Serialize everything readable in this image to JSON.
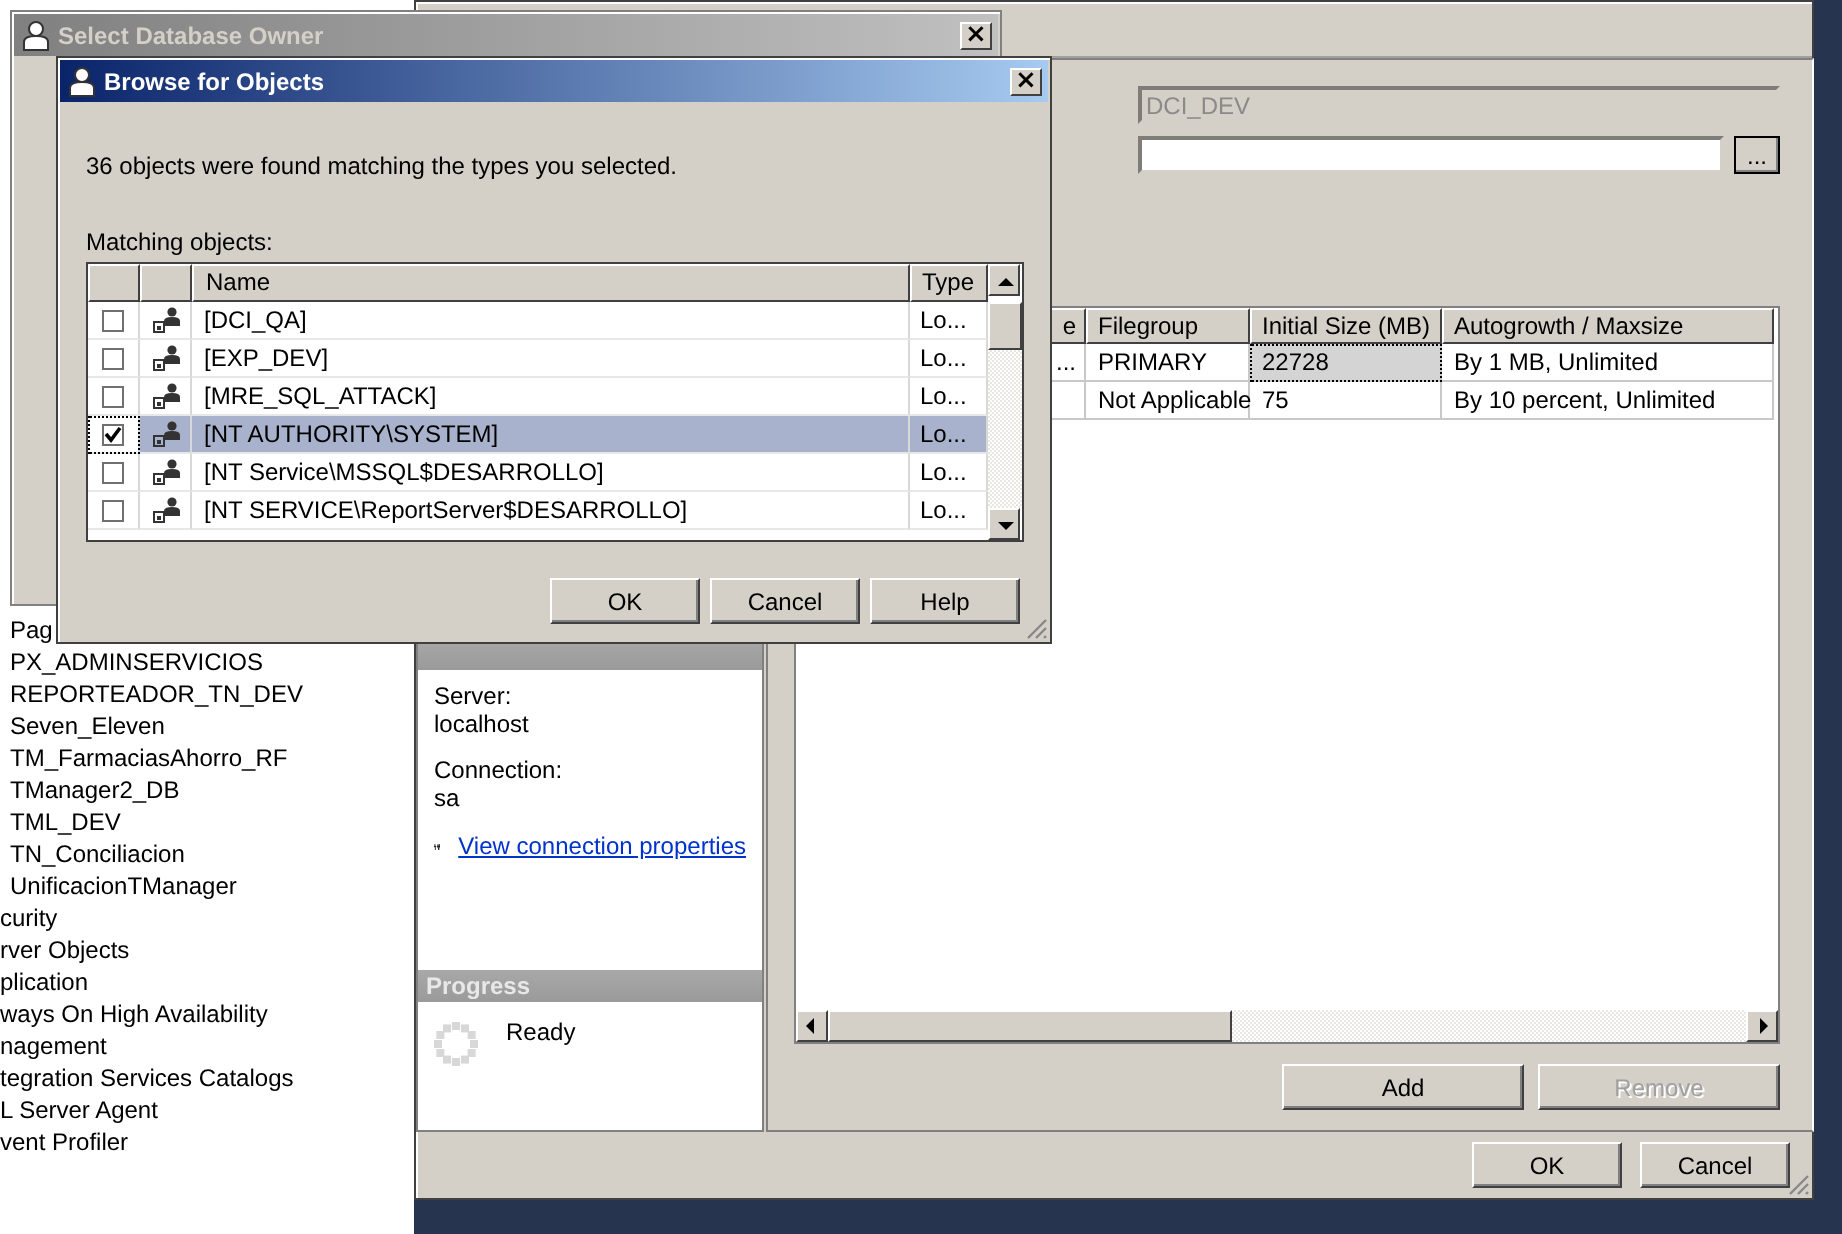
{
  "object_explorer": {
    "items": [
      {
        "label": "Pag",
        "kind": "database"
      },
      {
        "label": "PX_ADMINSERVICIOS",
        "kind": "database"
      },
      {
        "label": "REPORTEADOR_TN_DEV",
        "kind": "database"
      },
      {
        "label": "Seven_Eleven",
        "kind": "database"
      },
      {
        "label": "TM_FarmaciasAhorro_RF",
        "kind": "database"
      },
      {
        "label": "TManager2_DB",
        "kind": "database"
      },
      {
        "label": "TML_DEV",
        "kind": "database"
      },
      {
        "label": "TN_Conciliacion",
        "kind": "database"
      },
      {
        "label": "UnificacionTManager",
        "kind": "database"
      },
      {
        "label": "curity",
        "kind": "folder"
      },
      {
        "label": "rver Objects",
        "kind": "folder"
      },
      {
        "label": "plication",
        "kind": "folder"
      },
      {
        "label": "ways On High Availability",
        "kind": "folder"
      },
      {
        "label": "nagement",
        "kind": "folder"
      },
      {
        "label": "tegration Services Catalogs",
        "kind": "folder"
      },
      {
        "label": "L Server Agent",
        "kind": "folder"
      },
      {
        "label": "vent Profiler",
        "kind": "folder"
      }
    ]
  },
  "new_database_dialog": {
    "database_name": {
      "value": "DCI_DEV",
      "disabled": true
    },
    "owner_browse_button": "...",
    "connection": {
      "server_label": "Server:",
      "server": "localhost",
      "connection_label": "Connection:",
      "connection": "sa",
      "link": "View connection properties"
    },
    "progress": {
      "title": "Progress",
      "status": "Ready"
    },
    "files_grid": {
      "columns": [
        "e",
        "Filegroup",
        "Initial Size (MB)",
        "Autogrowth / Maxsize"
      ],
      "rows": [
        {
          "cells": [
            {
              "text": "...",
              "focused": false
            },
            {
              "text": "PRIMARY",
              "focused": false
            },
            {
              "text": "22728",
              "focused": true
            },
            {
              "text": "By 1 MB, Unlimited",
              "focused": false
            }
          ]
        },
        {
          "cells": [
            {
              "text": "",
              "focused": false
            },
            {
              "text": "Not Applicable",
              "focused": false
            },
            {
              "text": "75",
              "focused": false
            },
            {
              "text": "By 10 percent, Unlimited",
              "focused": false
            }
          ]
        }
      ]
    },
    "grid_buttons": [
      {
        "label": "Add",
        "disabled": false
      },
      {
        "label": "Remove",
        "disabled": true
      }
    ],
    "footer_buttons": [
      {
        "label": "OK"
      },
      {
        "label": "Cancel"
      }
    ]
  },
  "select_owner_dialog": {
    "title": "Select Database Owner",
    "active": false,
    "close": "×"
  },
  "browse_dialog": {
    "title": "Browse for Objects",
    "active": true,
    "message": "36 objects were found matching the types you selected.",
    "list_label": "Matching objects:",
    "columns": [
      "Name",
      "Type"
    ],
    "rows": [
      {
        "name": "[DCI_QA]",
        "type": "Lo...",
        "checked": false,
        "selected": false
      },
      {
        "name": "[EXP_DEV]",
        "type": "Lo...",
        "checked": false,
        "selected": false
      },
      {
        "name": "[MRE_SQL_ATTACK]",
        "type": "Lo...",
        "checked": false,
        "selected": false
      },
      {
        "name": "[NT AUTHORITY\\SYSTEM]",
        "type": "Lo...",
        "checked": true,
        "selected": true
      },
      {
        "name": "[NT Service\\MSSQL$DESARROLLO]",
        "type": "Lo...",
        "checked": false,
        "selected": false
      },
      {
        "name": "[NT SERVICE\\ReportServer$DESARROLLO]",
        "type": "Lo...",
        "checked": false,
        "selected": false
      }
    ],
    "buttons": [
      "OK",
      "Cancel",
      "Help"
    ]
  }
}
